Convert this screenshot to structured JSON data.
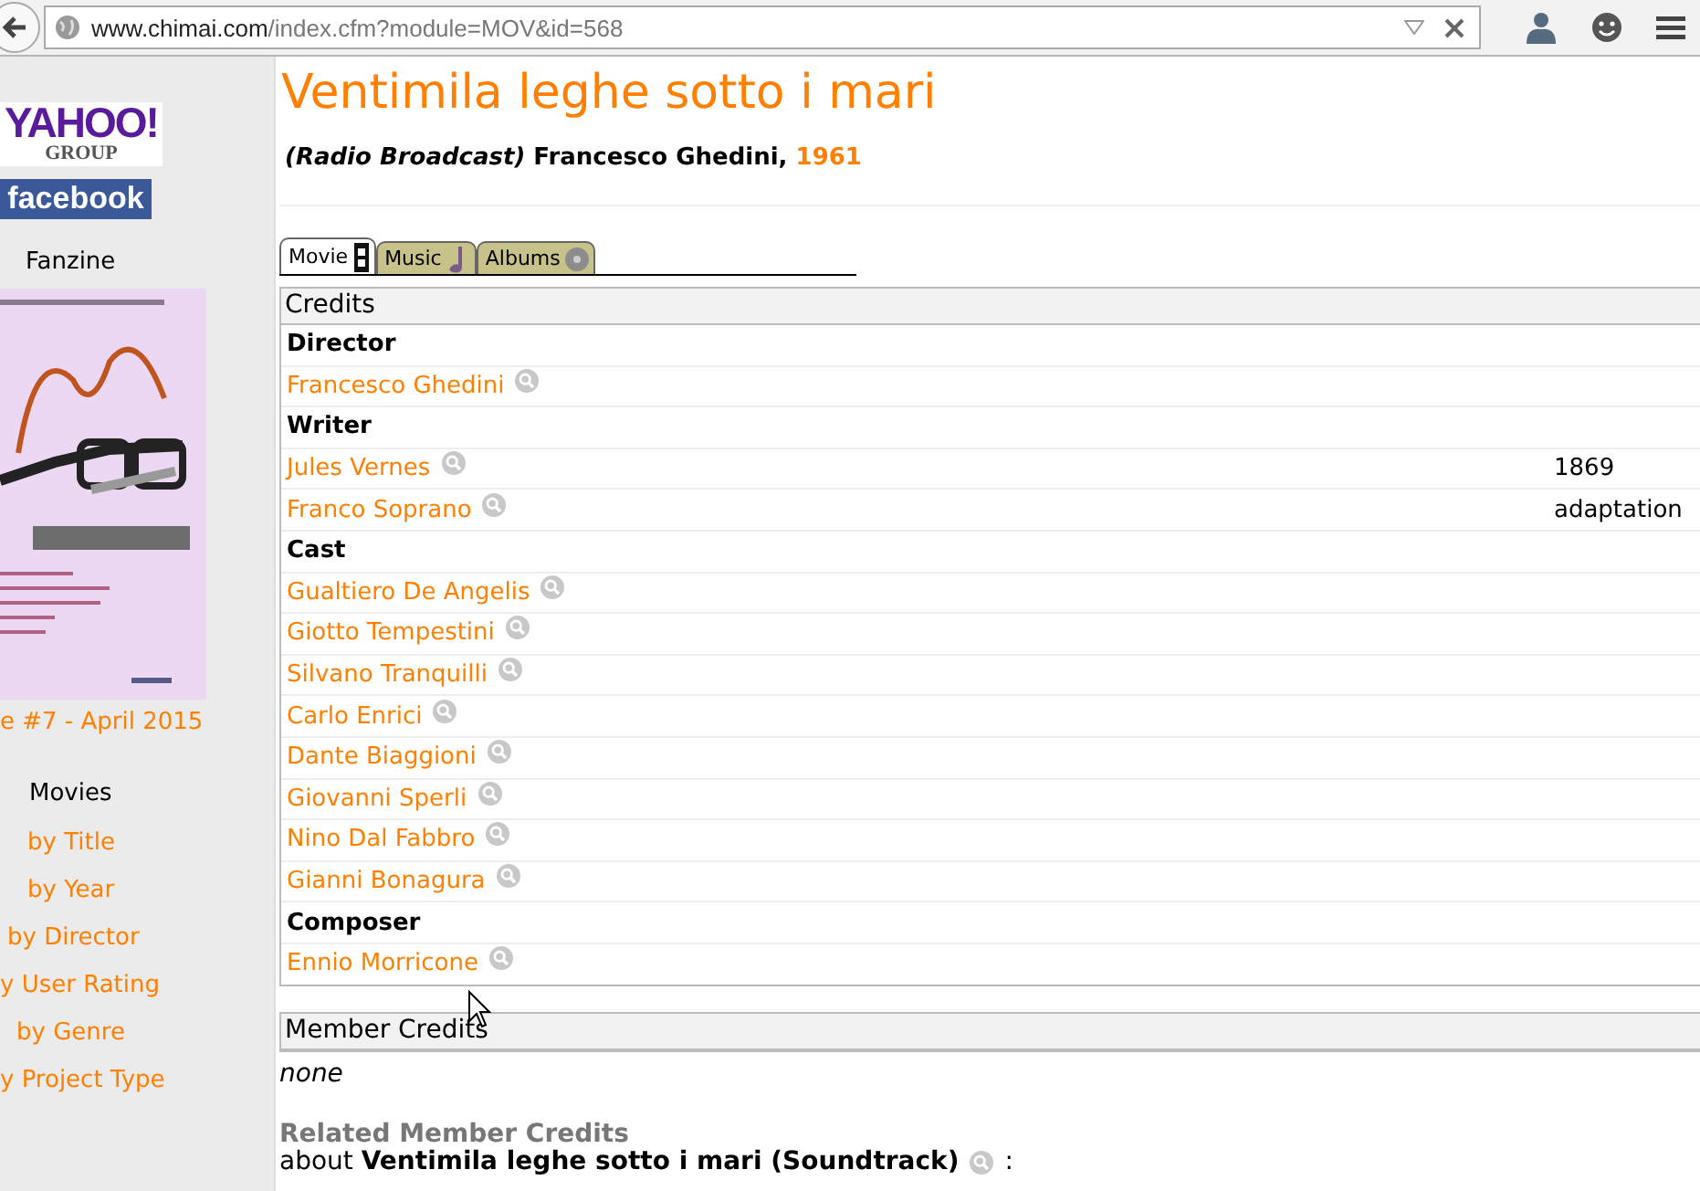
{
  "browser": {
    "url_host": "www.chimai.com",
    "url_path": "/index.cfm?module=MOV&id=568"
  },
  "sidebar": {
    "logos": [
      {
        "kind": "yahoo",
        "text": "YAHOO!",
        "sub": "GROUP"
      },
      {
        "kind": "facebook",
        "text": "facebook"
      }
    ],
    "fanzine_heading": "Fanzine",
    "fanzine_link": "e #7 - April 2015",
    "movies_heading": "Movies",
    "movie_links": [
      "by Title",
      "by Year",
      "by Director",
      "y User Rating",
      "by Genre",
      "y Project Type"
    ]
  },
  "title": "Ventimila leghe sotto i mari",
  "subtitle": "*(Radio Broadcast)* Francesco Ghedini,",
  "year": "1961",
  "tabs": [
    {
      "label": "Movie",
      "kind": "film",
      "selected": true
    },
    {
      "label": "Music",
      "kind": "note",
      "selected": false
    },
    {
      "label": "Albums",
      "kind": "disc",
      "selected": false
    }
  ],
  "credits": {
    "heading": "Credits",
    "rows": [
      {
        "kind": "role",
        "text": "Director"
      },
      {
        "kind": "person",
        "name": "Francesco Ghedini"
      },
      {
        "kind": "role",
        "text": "Writer"
      },
      {
        "kind": "person",
        "name": "Jules Vernes",
        "note": "1869"
      },
      {
        "kind": "person",
        "name": "Franco Soprano",
        "note": "adaptation"
      },
      {
        "kind": "role",
        "text": "Cast"
      },
      {
        "kind": "person",
        "name": "Gualtiero De Angelis"
      },
      {
        "kind": "person",
        "name": "Giotto Tempestini"
      },
      {
        "kind": "person",
        "name": "Silvano Tranquilli"
      },
      {
        "kind": "person",
        "name": "Carlo Enrici"
      },
      {
        "kind": "person",
        "name": "Dante Biaggioni"
      },
      {
        "kind": "person",
        "name": "Giovanni Sperli"
      },
      {
        "kind": "person",
        "name": "Nino Dal Fabbro"
      },
      {
        "kind": "person",
        "name": "Gianni Bonagura"
      },
      {
        "kind": "role",
        "text": "Composer"
      },
      {
        "kind": "person",
        "name": "Ennio Morricone"
      }
    ]
  },
  "member_credits": {
    "heading": "Member Credits",
    "value": "none"
  },
  "related": {
    "heading": "Related Member Credits",
    "about": "about **Ventimila leghe sotto i mari (Soundtrack)**",
    "suffix": ":"
  }
}
